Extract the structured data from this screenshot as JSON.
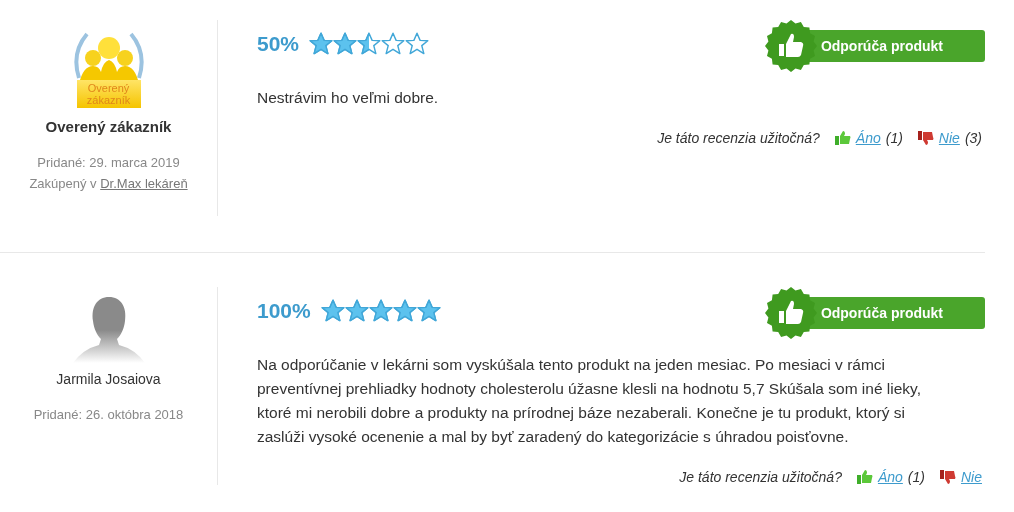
{
  "reviews": [
    {
      "author": {
        "kind": "verified",
        "badge_label": "Overený zákazník",
        "name": "Overený zákazník",
        "added": "Pridané: 29. marca 2019",
        "purchased_prefix": "Zakúpený v",
        "purchased_link": "Dr.Max lekáreň"
      },
      "percent": "50%",
      "stars": 2.5,
      "recommend": "Odporúča produkt",
      "text": "Nestrávim ho veľmi dobre.",
      "helpful": {
        "question": "Je táto recenzia užitočná?",
        "yes": "Áno",
        "yes_count": "(1)",
        "no": "Nie",
        "no_count": "(3)"
      }
    },
    {
      "author": {
        "kind": "person",
        "name": "Jarmila Josaiova",
        "added": "Pridané: 26. októbra 2018"
      },
      "percent": "100%",
      "stars": 5,
      "recommend": "Odporúča produkt",
      "text": "Na odporúčanie v lekárni som vyskúšala tento produkt na jeden mesiac. Po mesiaci v rámci preventívnej prehliadky hodnoty cholesterolu úžasne klesli na hodnotu 5,7 Skúšala som iné lieky, ktoré mi nerobili dobre a produkty na prírodnej báze nezaberali. Konečne je tu produkt, ktorý si zaslúži vysoké ocenenie a mal by byť zaradený do kategorizácie s úhradou poisťovne.",
      "helpful": {
        "question": "Je táto recenzia užitočná?",
        "yes": "Áno",
        "yes_count": "(1)",
        "no": "Nie"
      }
    }
  ]
}
